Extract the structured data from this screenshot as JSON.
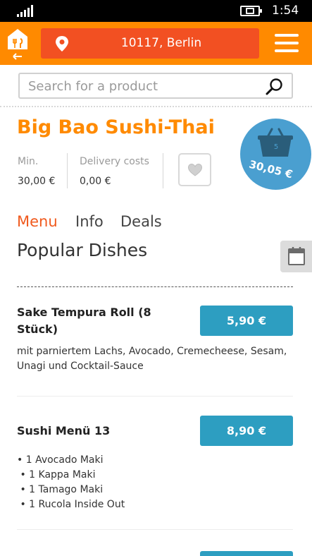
{
  "status_bar": {
    "time": "1:54",
    "signal_icon": "signal-bars-icon",
    "battery_icon": "battery-charging-icon"
  },
  "header": {
    "home_icon": "takeaway-logo-icon",
    "location": "10117, Berlin",
    "location_icon": "map-pin-icon",
    "menu_icon": "hamburger-menu-icon",
    "background_color": "#ff8a00",
    "location_color": "#f25022"
  },
  "search": {
    "placeholder": "Search for a product",
    "icon": "search-icon"
  },
  "restaurant": {
    "name": "Big Bao Sushi-Thai",
    "min_label": "Min.",
    "min_value": "30,00 €",
    "delivery_label": "Delivery costs",
    "delivery_value": "0,00 €",
    "favorite_icon": "heart-icon",
    "brand_color": "#ff8a00"
  },
  "basket": {
    "count": "5",
    "total": "30,05 €",
    "icon": "basket-icon",
    "color": "#4a9fd0"
  },
  "tabs": [
    {
      "label": "Menu",
      "active": true
    },
    {
      "label": "Info",
      "active": false
    },
    {
      "label": "Deals",
      "active": false
    }
  ],
  "section_title": "Popular Dishes",
  "side_button_icon": "calendar-icon",
  "dishes": [
    {
      "name_lines": [
        "Sake Tempura Roll (8",
        "Stück)"
      ],
      "price": "5,90 €",
      "description_lines": [
        "mit parniertem Lachs, Avocado, Cremecheese, Sesam,",
        "Unagi und Cocktail-Sauce"
      ]
    },
    {
      "name_lines": [
        "Sushi Menü 13"
      ],
      "price": "8,90 €",
      "description_lines": [
        "• 1 Avocado Maki",
        " • 1 Kappa Maki",
        " • 1 Tamago Maki",
        " • 1 Rucola Inside Out"
      ]
    }
  ],
  "price_button_color": "#2d9ec1"
}
